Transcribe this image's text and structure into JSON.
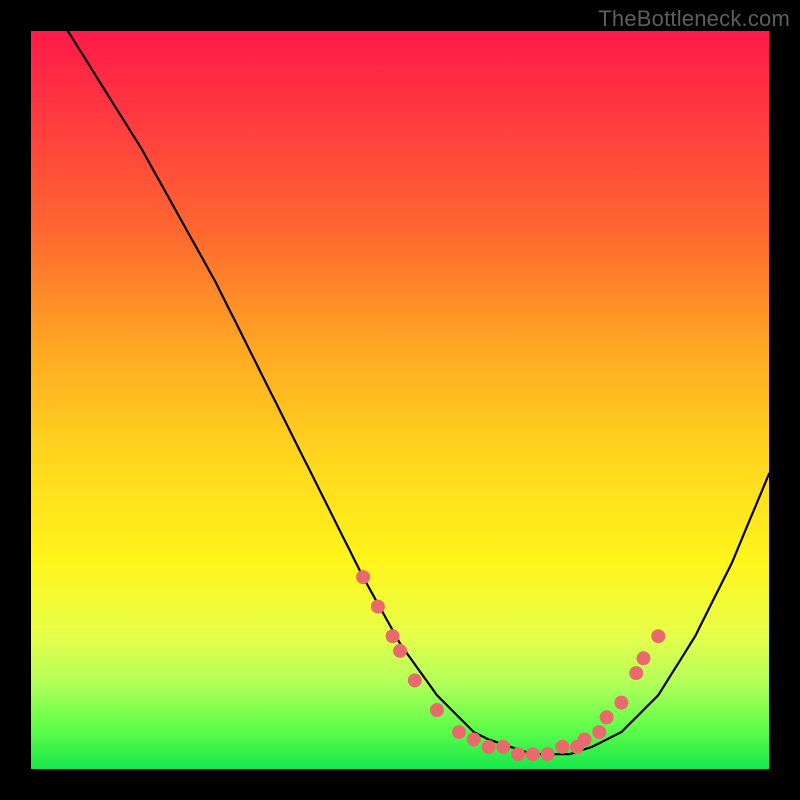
{
  "watermark": "TheBottleneck.com",
  "colors": {
    "dot": "#e86a6d",
    "curve": "#000000",
    "gradient_top": "#ff1a49",
    "gradient_bottom": "#17e84a"
  },
  "chart_data": {
    "type": "line",
    "title": "",
    "xlabel": "",
    "ylabel": "",
    "xlim": [
      0,
      100
    ],
    "ylim": [
      0,
      100
    ],
    "grid": false,
    "legend": false,
    "series": [
      {
        "name": "curve",
        "x": [
          5,
          10,
          15,
          20,
          25,
          30,
          35,
          40,
          45,
          50,
          55,
          60,
          62,
          65,
          68,
          70,
          73,
          76,
          80,
          85,
          90,
          95,
          100
        ],
        "y": [
          100,
          92,
          84,
          75,
          66,
          56,
          46,
          36,
          26,
          17,
          10,
          5,
          4,
          3,
          2,
          2,
          2,
          3,
          5,
          10,
          18,
          28,
          40
        ]
      }
    ],
    "markers": [
      {
        "x": 45,
        "y": 26
      },
      {
        "x": 47,
        "y": 22
      },
      {
        "x": 49,
        "y": 18
      },
      {
        "x": 50,
        "y": 16
      },
      {
        "x": 52,
        "y": 12
      },
      {
        "x": 55,
        "y": 8
      },
      {
        "x": 58,
        "y": 5
      },
      {
        "x": 60,
        "y": 4
      },
      {
        "x": 62,
        "y": 3
      },
      {
        "x": 64,
        "y": 3
      },
      {
        "x": 66,
        "y": 2
      },
      {
        "x": 68,
        "y": 2
      },
      {
        "x": 70,
        "y": 2
      },
      {
        "x": 72,
        "y": 3
      },
      {
        "x": 74,
        "y": 3
      },
      {
        "x": 75,
        "y": 4
      },
      {
        "x": 77,
        "y": 5
      },
      {
        "x": 78,
        "y": 7
      },
      {
        "x": 80,
        "y": 9
      },
      {
        "x": 82,
        "y": 13
      },
      {
        "x": 83,
        "y": 15
      },
      {
        "x": 85,
        "y": 18
      }
    ]
  }
}
